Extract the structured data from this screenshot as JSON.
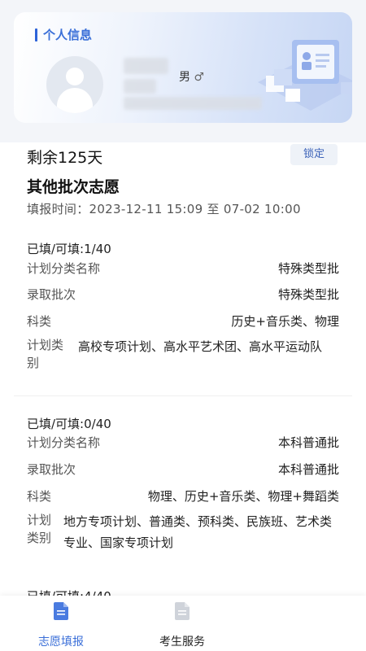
{
  "profile": {
    "title": "个人信息",
    "gender": "男",
    "gender_icon": "♂"
  },
  "header": {
    "countdown": "剩余125天",
    "lock_label": "锁定",
    "batch_title": "其他批次志愿",
    "fill_time": "填报时间：2023-12-11 15:09 至 07-02 10:00"
  },
  "groups": [
    {
      "filled": "已填/可填:1/40",
      "rows": [
        {
          "label": "计划分类名称",
          "value": "特殊类型批"
        },
        {
          "label": "录取批次",
          "value": "特殊类型批"
        },
        {
          "label": "科类",
          "value": "历史+音乐类、物理"
        },
        {
          "label": "计划类别",
          "value": "高校专项计划、高水平艺术团、高水平运动队"
        }
      ]
    },
    {
      "filled": "已填/可填:0/40",
      "rows": [
        {
          "label": "计划分类名称",
          "value": "本科普通批"
        },
        {
          "label": "录取批次",
          "value": "本科普通批"
        },
        {
          "label": "科类",
          "value": "物理、历史+音乐类、物理+舞蹈类"
        },
        {
          "label": "计划类别",
          "value": "地方专项计划、普通类、预科类、民族班、艺术类专业、国家专项计划"
        }
      ]
    },
    {
      "filled": "已填/可填:4/40"
    }
  ],
  "nav": {
    "items": [
      {
        "label": "志愿填报",
        "active": true
      },
      {
        "label": "考生服务",
        "active": false
      }
    ]
  },
  "colors": {
    "accent": "#3a6fd8",
    "active_nav": "#3b6fd8",
    "inactive_nav": "#222222"
  }
}
